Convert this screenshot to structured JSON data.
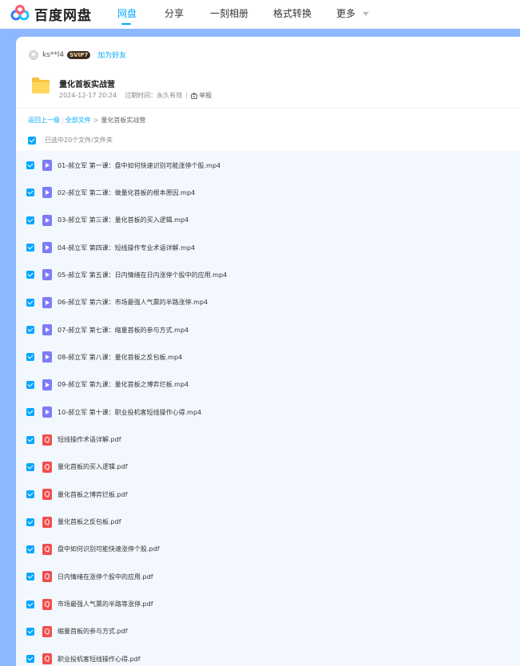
{
  "brand": {
    "name": "百度网盘"
  },
  "nav": {
    "items": [
      {
        "label": "网盘",
        "active": true
      },
      {
        "label": "分享",
        "active": false
      },
      {
        "label": "一刻相册",
        "active": false
      },
      {
        "label": "格式转换",
        "active": false
      },
      {
        "label": "更多",
        "active": false
      }
    ]
  },
  "user": {
    "name": "ks**l4",
    "vip": "SVIP7",
    "add_friend": "加为好友"
  },
  "share": {
    "title": "量化首板实战营",
    "date": "2024-12-17 20:24",
    "expire_label": "过期时间：永久有效",
    "report": "举报"
  },
  "breadcrumb": {
    "back": "返回上一级",
    "all": "全部文件",
    "current": "量化首板实战营"
  },
  "selection": {
    "text": "已选中20个文件/文件夹"
  },
  "files": [
    {
      "name": "01-郝立军 第一课：盘中如何快速识别可能涨停个股.mp4",
      "type": "video"
    },
    {
      "name": "02-郝立军 第二课：做量化首板的根本原因.mp4",
      "type": "video"
    },
    {
      "name": "03-郝立军 第三课：量化首板的买入逻辑.mp4",
      "type": "video"
    },
    {
      "name": "04-郝立军 第四课：短线操作专业术语详解.mp4",
      "type": "video"
    },
    {
      "name": "05-郝立军 第五课：日内情绪在日内涨停个股中的应用.mp4",
      "type": "video"
    },
    {
      "name": "06-郝立军 第六课：市场最强人气票的半路涨停.mp4",
      "type": "video"
    },
    {
      "name": "07-郝立军 第七课：缩量首板的参与方式.mp4",
      "type": "video"
    },
    {
      "name": "08-郝立军 第八课：量化首板之反包板.mp4",
      "type": "video"
    },
    {
      "name": "09-郝立军 第九课：量化首板之博弈烂板.mp4",
      "type": "video"
    },
    {
      "name": "10-郝立军 第十课：职业投机客短线操作心得.mp4",
      "type": "video"
    },
    {
      "name": "短线操作术语详解.pdf",
      "type": "pdf"
    },
    {
      "name": "量化首板的买入逻辑.pdf",
      "type": "pdf"
    },
    {
      "name": "量化首板之博弈烂板.pdf",
      "type": "pdf"
    },
    {
      "name": "量化首板之反包板.pdf",
      "type": "pdf"
    },
    {
      "name": "盘中如何识别可能快速涨停个股.pdf",
      "type": "pdf"
    },
    {
      "name": "日内情绪在涨停个股中的应用.pdf",
      "type": "pdf"
    },
    {
      "name": "市场最强人气票的半路等涨停.pdf",
      "type": "pdf"
    },
    {
      "name": "缩量首板的参与方式.pdf",
      "type": "pdf"
    },
    {
      "name": "职业投机客短线操作心得.pdf",
      "type": "pdf"
    }
  ],
  "colors": {
    "accent": "#06a7ff",
    "band": "#8db7ff",
    "list_bg": "#f3f8ff"
  }
}
